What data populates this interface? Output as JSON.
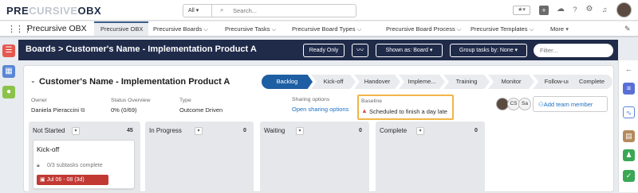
{
  "app": {
    "logo_main": "PRE",
    "logo_faint": "CURSIVE",
    "logo_tail": "OBX"
  },
  "search": {
    "scope": "All",
    "placeholder": "Search..."
  },
  "nav": {
    "app_name": "Precursive OBX",
    "tabs": [
      {
        "label": "Precursive OBX"
      },
      {
        "label": "Precursive Boards"
      },
      {
        "label": "Precursive Tasks"
      },
      {
        "label": "Precursive Board Types"
      },
      {
        "label": "Precursive Board Process"
      },
      {
        "label": "Precursive Templates"
      },
      {
        "label": "More"
      }
    ]
  },
  "board_bar": {
    "breadcrumb": "Boards > Customer's Name - Implementation Product A",
    "ready_only": "Ready Only",
    "shown_as": "Shown as: Board",
    "group_tasks": "Group tasks by: None",
    "filter_placeholder": "Filter..."
  },
  "record": {
    "title": "Customer's Name - Implementation Product A",
    "stages": [
      "Backlog",
      "Kick-off",
      "Handover",
      "Impleme...",
      "Training",
      "Monitor",
      "Follow-up",
      "Complete"
    ],
    "current_stage": "Backlog",
    "owner_label": "Owner",
    "owner_value": "Daniela Pieraccini",
    "status_label": "Status Overview",
    "status_value": "0% (0/69)",
    "type_label": "Type",
    "type_value": "Outcome Driven",
    "sharing_label": "Sharing options",
    "sharing_link": "Open sharing options",
    "baseline_label": "Baseline",
    "baseline_value": "Scheduled to finish a day late",
    "avatars": [
      "CS",
      "Sa"
    ],
    "add_member": "Add team member"
  },
  "columns": [
    {
      "name": "Not Started",
      "count": "45"
    },
    {
      "name": "In Progress",
      "count": "0"
    },
    {
      "name": "Waiting",
      "count": "0"
    },
    {
      "name": "Complete",
      "count": "0"
    }
  ],
  "task": {
    "title": "Kick-off",
    "subtasks": "0/3 subtasks complete",
    "date": "Jul 06 - 08 (3d)"
  },
  "colors": {
    "brand_dark": "#202b4a",
    "path_active": "#1e5ea3",
    "baseline_border": "#f2b449",
    "date_badge": "#c23934",
    "link": "#1c6fc2"
  },
  "icons": [
    "grid-icon",
    "search-icon",
    "star-icon",
    "plus-icon",
    "bell-icon",
    "help-icon",
    "gear-icon",
    "pencil-icon",
    "pulse-icon",
    "warning-icon",
    "external-link-icon",
    "lock-icon",
    "calendar-icon",
    "user-plus-icon",
    "back-arrow-icon"
  ]
}
